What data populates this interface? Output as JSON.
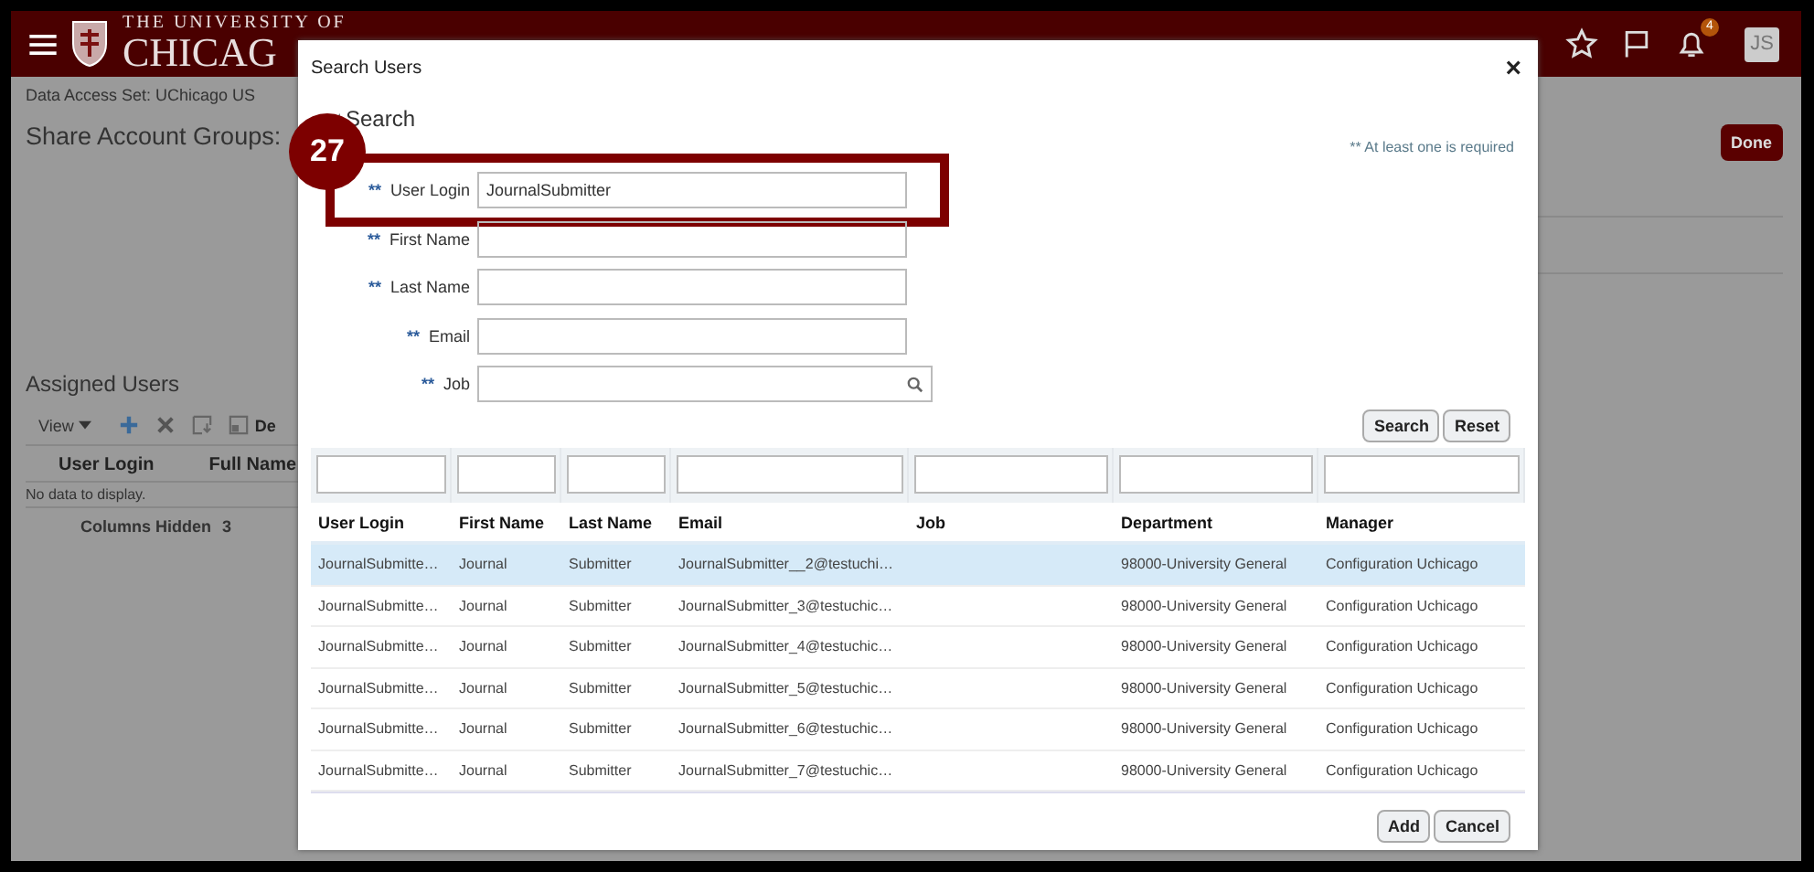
{
  "header": {
    "logo_small": "THE UNIVERSITY OF",
    "logo_large": "CHICAG",
    "notifications": "4",
    "avatar": "JS"
  },
  "page": {
    "data_access": "Data Access Set: UChicago US",
    "title": "Share Account Groups:",
    "done": "Done",
    "section": "Assigned Users",
    "toolbar_view": "View",
    "toolbar_cut": "De",
    "columns": [
      "User Login",
      "Full Name"
    ],
    "empty": "No data to display.",
    "hidden_label": "Columns Hidden",
    "hidden_count": "3"
  },
  "dialog": {
    "title": "Search Users",
    "close": "×",
    "section": "Search",
    "required_note": "** At least one is required",
    "step": "27",
    "fields": [
      {
        "mark": "**",
        "label": "User Login",
        "value": "JournalSubmitter",
        "kind": "text",
        "highlighted": true
      },
      {
        "mark": "**",
        "label": "First Name",
        "kind": "text",
        "highlighted": false
      },
      {
        "mark": "**",
        "label": "Last Name",
        "kind": "text",
        "highlighted": false
      },
      {
        "mark": "**",
        "label": "Email",
        "kind": "text",
        "highlighted": false
      },
      {
        "mark": "**",
        "label": "Job",
        "kind": "lookup",
        "highlighted": false
      }
    ],
    "buttons": [
      "Search",
      "Reset"
    ],
    "table": {
      "columns": [
        "User Login",
        "First Name",
        "Last Name",
        "Email",
        "Job",
        "Department",
        "Manager"
      ],
      "rows": [
        {
          "selected": true,
          "cells": [
            "JournalSubmitte…",
            "Journal",
            "Submitter",
            "JournalSubmitter__2@testuchi…",
            "",
            "98000-University General",
            "Configuration Uchicago"
          ]
        },
        {
          "selected": false,
          "cells": [
            "JournalSubmitte…",
            "Journal",
            "Submitter",
            "JournalSubmitter_3@testuchic…",
            "",
            "98000-University General",
            "Configuration Uchicago"
          ]
        },
        {
          "selected": false,
          "cells": [
            "JournalSubmitte…",
            "Journal",
            "Submitter",
            "JournalSubmitter_4@testuchic…",
            "",
            "98000-University General",
            "Configuration Uchicago"
          ]
        },
        {
          "selected": false,
          "cells": [
            "JournalSubmitte…",
            "Journal",
            "Submitter",
            "JournalSubmitter_5@testuchic…",
            "",
            "98000-University General",
            "Configuration Uchicago"
          ]
        },
        {
          "selected": false,
          "cells": [
            "JournalSubmitte…",
            "Journal",
            "Submitter",
            "JournalSubmitter_6@testuchic…",
            "",
            "98000-University General",
            "Configuration Uchicago"
          ]
        },
        {
          "selected": false,
          "cells": [
            "JournalSubmitte…",
            "Journal",
            "Submitter",
            "JournalSubmitter_7@testuchic…",
            "",
            "98000-University General",
            "Configuration Uchicago"
          ]
        }
      ]
    },
    "footer_buttons": [
      "Add",
      "Cancel"
    ]
  }
}
